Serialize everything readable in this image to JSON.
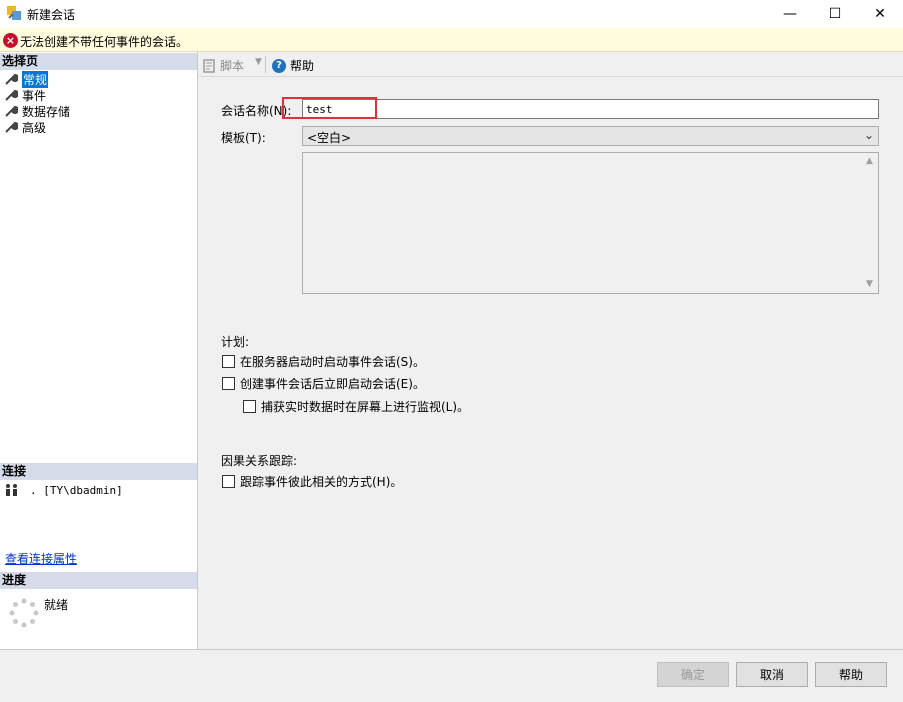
{
  "window": {
    "title": "新建会话",
    "min_glyph": "—",
    "max_glyph": "☐",
    "close_glyph": "✕"
  },
  "error": {
    "message": "无法创建不带任何事件的会话。",
    "icon": "error-x-icon"
  },
  "left": {
    "select_page_header": "选择页",
    "pages": [
      {
        "label": "常规",
        "selected": true
      },
      {
        "label": "事件",
        "selected": false
      },
      {
        "label": "数据存储",
        "selected": false
      },
      {
        "label": "高级",
        "selected": false
      }
    ],
    "connection_header": "连接",
    "connection_value": ". [TY\\dbadmin]",
    "connection_link": "查看连接属性",
    "progress_header": "进度",
    "progress_status": "就绪"
  },
  "toolbar": {
    "script_label": "脚本",
    "help_label": "帮助"
  },
  "form": {
    "session_name_label": "会话名称(N):",
    "session_name_value": "test",
    "template_label": "模板(T):",
    "template_value": "<空白>",
    "schedule_label": "计划:",
    "cb_start_on_server": "在服务器启动时启动事件会话(S)。",
    "cb_start_after_create": "创建事件会话后立即启动会话(E)。",
    "cb_watch_live": "捕获实时数据时在屏幕上进行监视(L)。",
    "causality_label": "因果关系跟踪:",
    "cb_track_causality": "跟踪事件彼此相关的方式(H)。"
  },
  "buttons": {
    "ok": "确定",
    "cancel": "取消",
    "help": "帮助"
  },
  "colors": {
    "selection": "#0078d7",
    "error_icon": "#c8102e",
    "highlight_border": "#e0313a",
    "section_header": "#d6dbe9"
  }
}
